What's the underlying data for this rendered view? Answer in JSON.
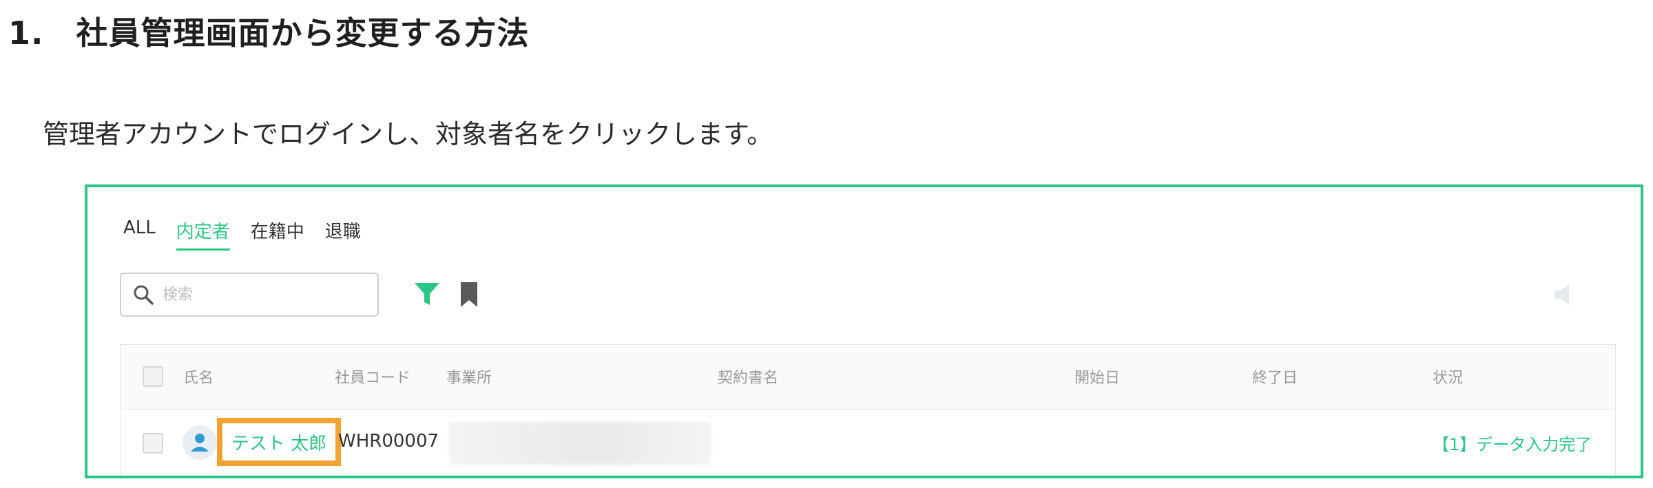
{
  "header": {
    "title": "1.　社員管理画面から変更する方法",
    "instruction": "管理者アカウントでログインし、対象者名をクリックします。"
  },
  "app": {
    "tabs": [
      {
        "label": "ALL",
        "active": false
      },
      {
        "label": "内定者",
        "active": true
      },
      {
        "label": "在籍中",
        "active": false
      },
      {
        "label": "退職",
        "active": false
      }
    ],
    "search": {
      "placeholder": "検索",
      "value": ""
    },
    "icons": [
      "search-icon",
      "filter-icon",
      "bookmark-icon",
      "speaker-icon"
    ],
    "accent_color": "#2cc584",
    "highlight_color": "#f0a330",
    "table": {
      "columns": [
        "氏名",
        "社員コード",
        "事業所",
        "契約書名",
        "開始日",
        "終了日",
        "状況"
      ],
      "rows": [
        {
          "name": "テスト 太郎",
          "code": "WHR00007",
          "office": "",
          "contract": "",
          "start": "",
          "end": "",
          "status": "【1】データ入力完了"
        }
      ]
    }
  }
}
